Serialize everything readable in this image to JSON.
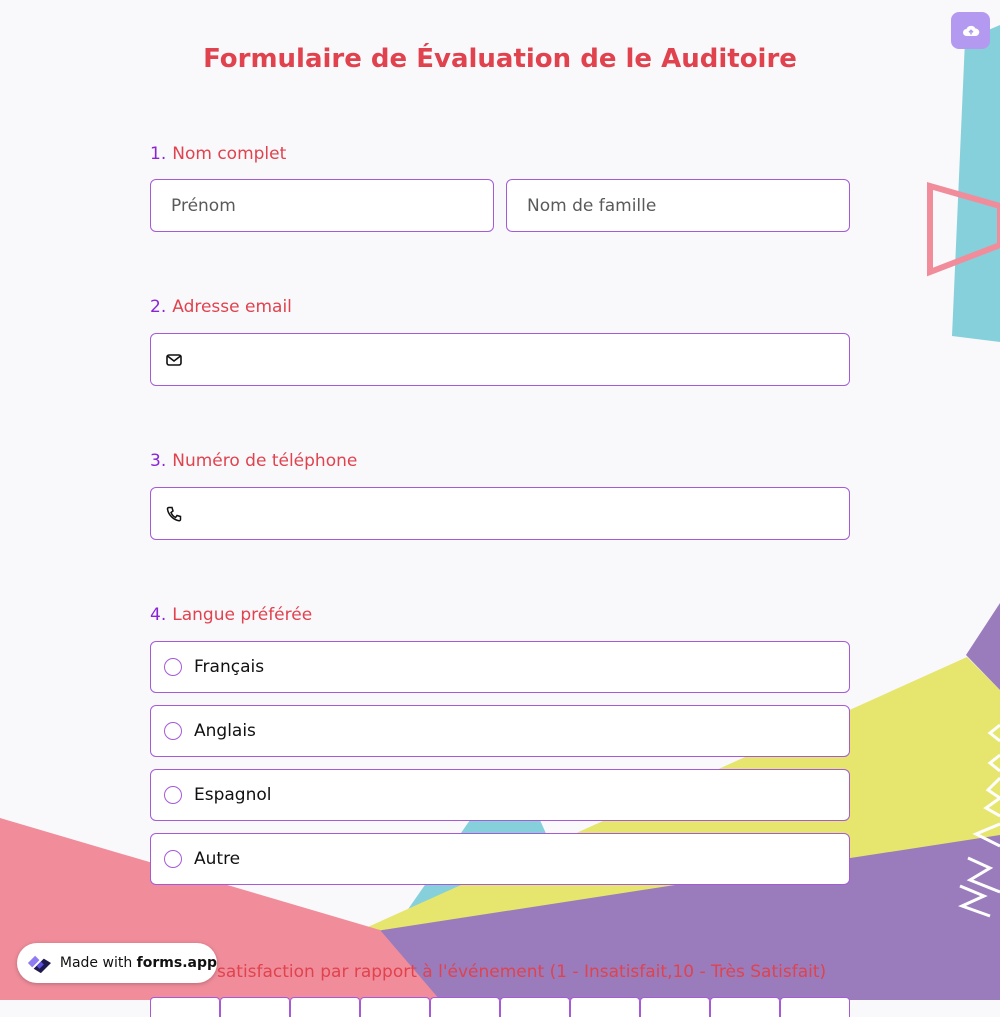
{
  "form": {
    "title": "Formulaire de Évaluation de le Auditoire",
    "questions": [
      {
        "number": "1.",
        "label": "Nom complet",
        "fields": [
          {
            "placeholder": "Prénom"
          },
          {
            "placeholder": "Nom de famille"
          }
        ]
      },
      {
        "number": "2.",
        "label": "Adresse email",
        "icon": "envelope-icon"
      },
      {
        "number": "3.",
        "label": "Numéro de téléphone",
        "icon": "phone-icon"
      },
      {
        "number": "4.",
        "label": "Langue préférée",
        "options": [
          "Français",
          "Anglais",
          "Espagnol",
          "Autre"
        ]
      },
      {
        "label": "satisfaction par rapport à l'événement (1 - Insatisfait,10 - Très Satisfait)"
      }
    ]
  },
  "badge": {
    "prefix": "Made with",
    "brand": "forms.app"
  },
  "upload_button": {
    "icon": "cloud-upload-icon"
  },
  "colors": {
    "accent": "#e0424e",
    "number": "#8b24d6",
    "border": "#a65ad8",
    "teal": "#86d0dc",
    "pink": "#f18d9b",
    "yellow": "#e6e66f",
    "purple": "#9a7cbd"
  }
}
